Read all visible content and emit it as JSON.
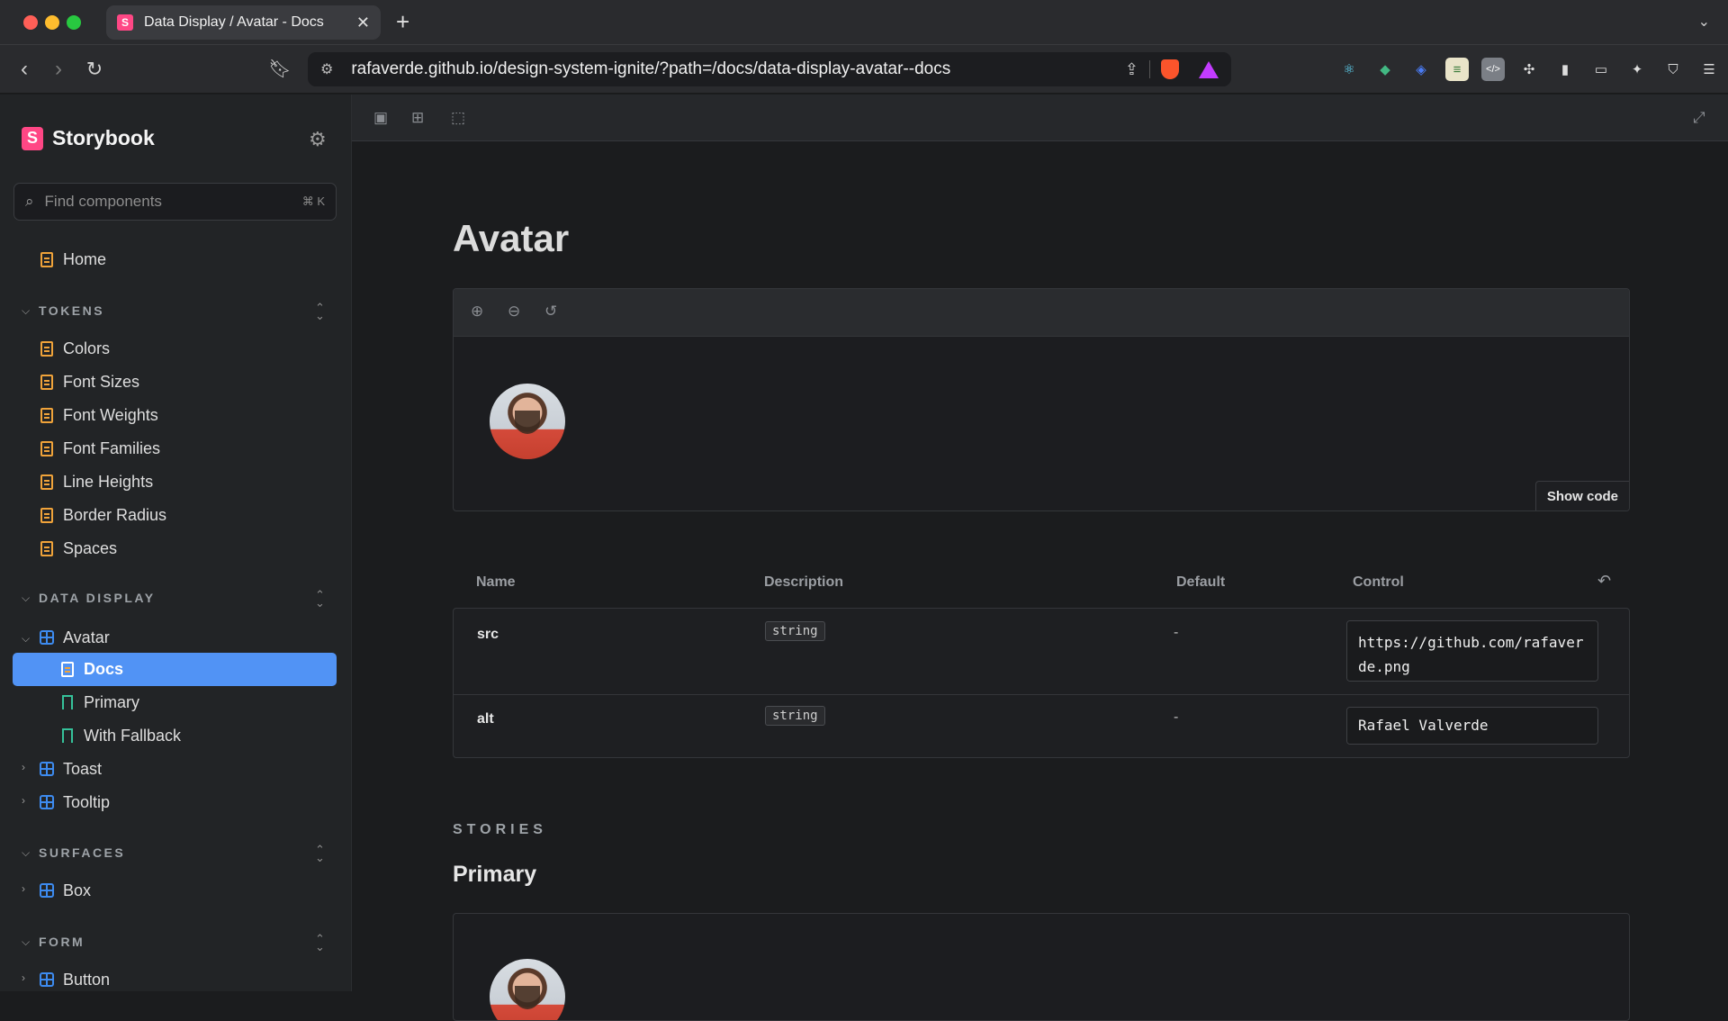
{
  "browser": {
    "tab_title": "Data Display / Avatar - Docs",
    "tab_favicon": "S",
    "url": "rafaverde.github.io/design-system-ignite/?path=/docs/data-display-avatar--docs"
  },
  "sidebar": {
    "logo_mark": "S",
    "logo_text": "Storybook",
    "search_placeholder": "Find components",
    "search_shortcut": "⌘ K",
    "home": "Home",
    "sections": {
      "tokens": {
        "title": "TOKENS",
        "items": [
          "Colors",
          "Font Sizes",
          "Font Weights",
          "Font Families",
          "Line Heights",
          "Border Radius",
          "Spaces"
        ]
      },
      "data_display": {
        "title": "DATA DISPLAY",
        "avatar": "Avatar",
        "avatar_children": [
          "Docs",
          "Primary",
          "With Fallback"
        ],
        "others": [
          "Toast",
          "Tooltip"
        ]
      },
      "surfaces": {
        "title": "SURFACES",
        "items": [
          "Box"
        ]
      },
      "form": {
        "title": "FORM",
        "items": [
          "Button"
        ]
      }
    }
  },
  "docs": {
    "title": "Avatar",
    "show_code": "Show code",
    "args": {
      "headers": {
        "name": "Name",
        "description": "Description",
        "default": "Default",
        "control": "Control"
      },
      "rows": [
        {
          "name": "src",
          "type": "string",
          "default": "-",
          "value": "https://github.com/rafaverde.png"
        },
        {
          "name": "alt",
          "type": "string",
          "default": "-",
          "value": "Rafael Valverde"
        }
      ]
    },
    "stories_label": "STORIES",
    "story_title": "Primary"
  },
  "colors": {
    "accent": "#5193f5",
    "storybook_brand": "#ff4785",
    "doc_icon": "#f0a33a",
    "component_icon": "#3d8bf0",
    "story_icon": "#35c29a"
  }
}
